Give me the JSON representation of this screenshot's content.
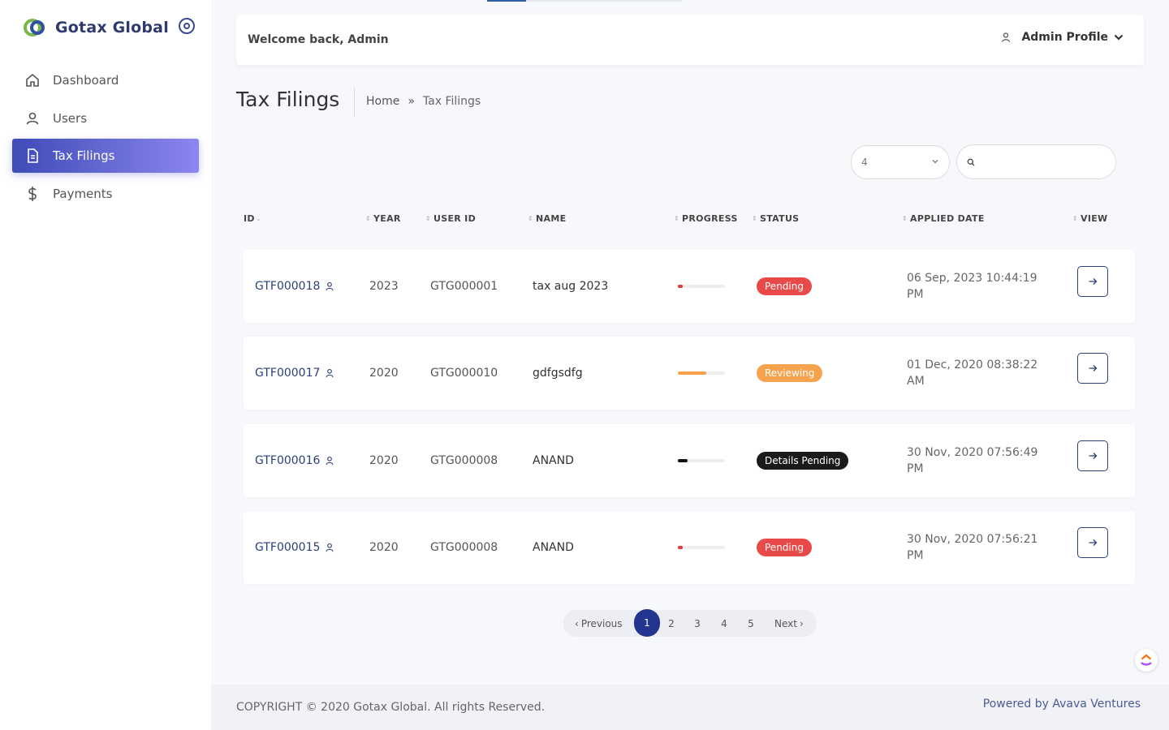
{
  "brand": {
    "name": "Gotax Global"
  },
  "sidebar": {
    "items": [
      {
        "label": "Dashboard",
        "icon": "home-icon"
      },
      {
        "label": "Users",
        "icon": "user-icon"
      },
      {
        "label": "Tax Filings",
        "icon": "document-icon",
        "active": true
      },
      {
        "label": "Payments",
        "icon": "dollar-icon"
      }
    ]
  },
  "header": {
    "welcome": "Welcome back, Admin",
    "profile": "Admin Profile"
  },
  "page": {
    "title": "Tax Filings"
  },
  "breadcrumb": {
    "home": "Home",
    "separator": "»",
    "current": "Tax Filings"
  },
  "controls": {
    "per_page": "4",
    "search_placeholder": ""
  },
  "table": {
    "columns": [
      "ID",
      "YEAR",
      "USER ID",
      "NAME",
      "PROGRESS",
      "STATUS",
      "APPLIED DATE",
      "VIEW"
    ],
    "rows": [
      {
        "id": "GTF000018",
        "year": "2023",
        "user_id": "GTG000001",
        "name": "tax aug 2023",
        "progress": 0.1,
        "progress_color": "#e53935",
        "status": "Pending",
        "status_color": "#e84a4a",
        "date_line1": "06 Sep, 2023 10:44:19",
        "date_line2": "PM"
      },
      {
        "id": "GTF000017",
        "year": "2020",
        "user_id": "GTG000010",
        "name": "gdfgsdfg",
        "progress": 0.6,
        "progress_color": "#f5a04a",
        "status": "Reviewing",
        "status_color": "#f7a24c",
        "date_line1": "01 Dec, 2020 08:38:22",
        "date_line2": "AM"
      },
      {
        "id": "GTF000016",
        "year": "2020",
        "user_id": "GTG000008",
        "name": "ANAND",
        "progress": 0.2,
        "progress_color": "#111111",
        "status": "Details Pending",
        "status_color": "#1a1a1a",
        "date_line1": "30 Nov, 2020 07:56:49",
        "date_line2": "PM"
      },
      {
        "id": "GTF000015",
        "year": "2020",
        "user_id": "GTG000008",
        "name": "ANAND",
        "progress": 0.1,
        "progress_color": "#e53935",
        "status": "Pending",
        "status_color": "#e84a4a",
        "date_line1": "30 Nov, 2020 07:56:21",
        "date_line2": "PM"
      }
    ]
  },
  "pagination": {
    "prev": "Previous",
    "next": "Next",
    "pages": [
      "1",
      "2",
      "3",
      "4",
      "5"
    ],
    "current": "1"
  },
  "footer": {
    "copyright": "COPYRIGHT © 2020 Gotax Global. All rights Reserved.",
    "powered": "Powered by Avava Ventures"
  }
}
